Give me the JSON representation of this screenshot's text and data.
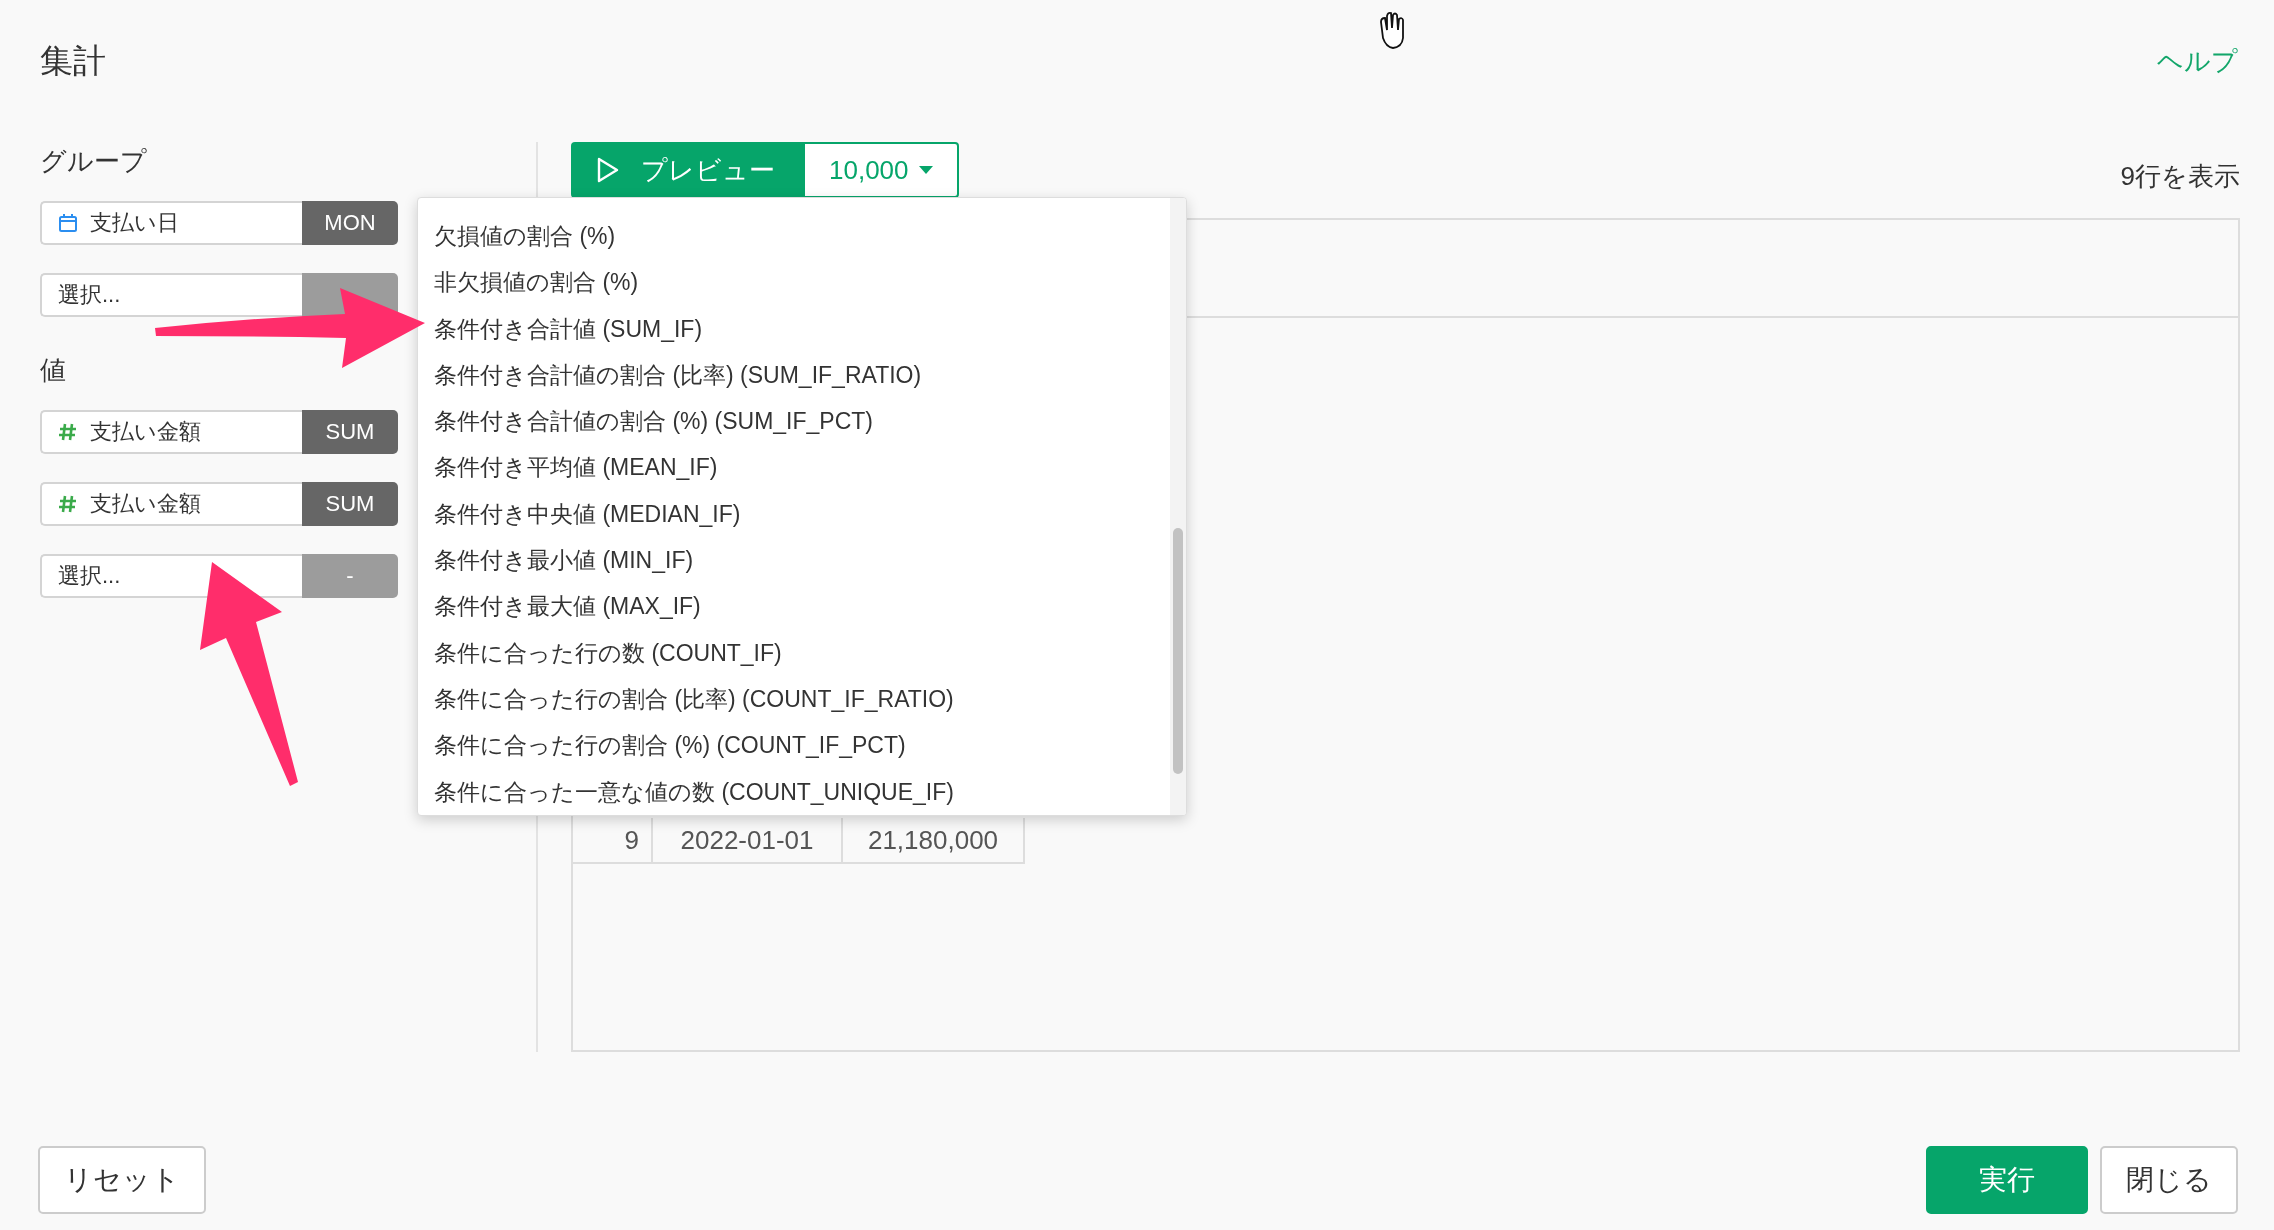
{
  "title": "集計",
  "help_link": "ヘルプ",
  "group": {
    "label": "グループ",
    "fields": [
      {
        "kind": "date",
        "name": "支払い日",
        "function": "MON"
      },
      {
        "kind": "empty",
        "placeholder": "選択..."
      }
    ]
  },
  "values": {
    "label": "値",
    "fields": [
      {
        "kind": "number",
        "name": "支払い金額",
        "function": "SUM"
      },
      {
        "kind": "number",
        "name": "支払い金額",
        "function": "SUM"
      },
      {
        "kind": "empty",
        "placeholder": "選択...",
        "function": "-"
      }
    ]
  },
  "preview": {
    "label": "プレビュー",
    "row_limit": "10,000",
    "row_count": "9行を表示"
  },
  "table": {
    "rows": [
      {
        "column_1": "9",
        "column_2": "2022-01-01",
        "column_3": "21,180,000"
      }
    ]
  },
  "function_menu": {
    "items": [
      "欠損値の割合 (%)",
      "非欠損値の割合 (%)",
      "条件付き合計値 (SUM_IF)",
      "条件付き合計値の割合 (比率) (SUM_IF_RATIO)",
      "条件付き合計値の割合 (%) (SUM_IF_PCT)",
      "条件付き平均値 (MEAN_IF)",
      "条件付き中央値 (MEDIAN_IF)",
      "条件付き最小値 (MIN_IF)",
      "条件付き最大値 (MAX_IF)",
      "条件に合った行の数 (COUNT_IF)",
      "条件に合った行の割合 (比率) (COUNT_IF_RATIO)",
      "条件に合った行の割合 (%) (COUNT_IF_PCT)",
      "条件に合った一意な値の数 (COUNT_UNIQUE_IF)"
    ]
  },
  "buttons": {
    "reset": "リセット",
    "run": "実行",
    "close": "閉じる"
  }
}
